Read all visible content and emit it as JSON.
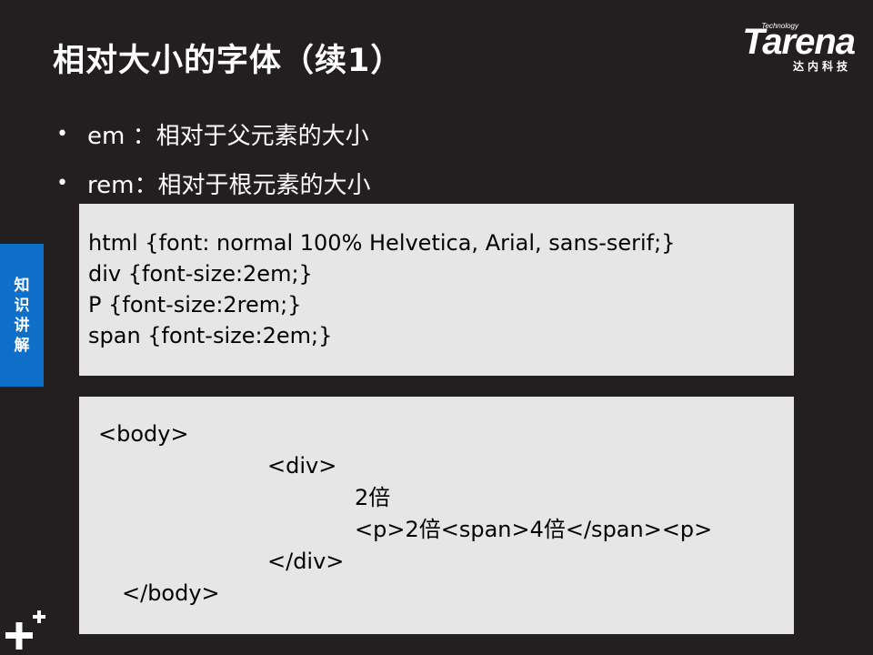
{
  "slide": {
    "title": "相对大小的字体（续1）"
  },
  "logo": {
    "technology": "Technology",
    "brand": "Tarena",
    "brand_cn": "达内科技"
  },
  "side_tab": {
    "chars": [
      "知",
      "识",
      "讲",
      "解"
    ]
  },
  "bullets": [
    {
      "marker": "•",
      "text": "em ：相对于父元素的大小"
    },
    {
      "marker": "•",
      "text": "rem：相对于根元素的大小"
    }
  ],
  "code_blocks": {
    "css": [
      "html {font: normal 100% Helvetica, Arial, sans-serif;}",
      "div {font-size:2em;}",
      "P {font-size:2rem;}",
      "span {font-size:2em;}"
    ],
    "html": [
      "<body>",
      "<div>",
      "2倍",
      "<p>2倍<span>4倍</span><p>",
      "</div>",
      "</body>"
    ]
  },
  "colors": {
    "background": "#231f20",
    "side_tab": "#0d6fc7",
    "code_box": "#e6e6e6",
    "text": "#ffffff"
  },
  "icons": {
    "corner": "plus-plus-icon"
  }
}
